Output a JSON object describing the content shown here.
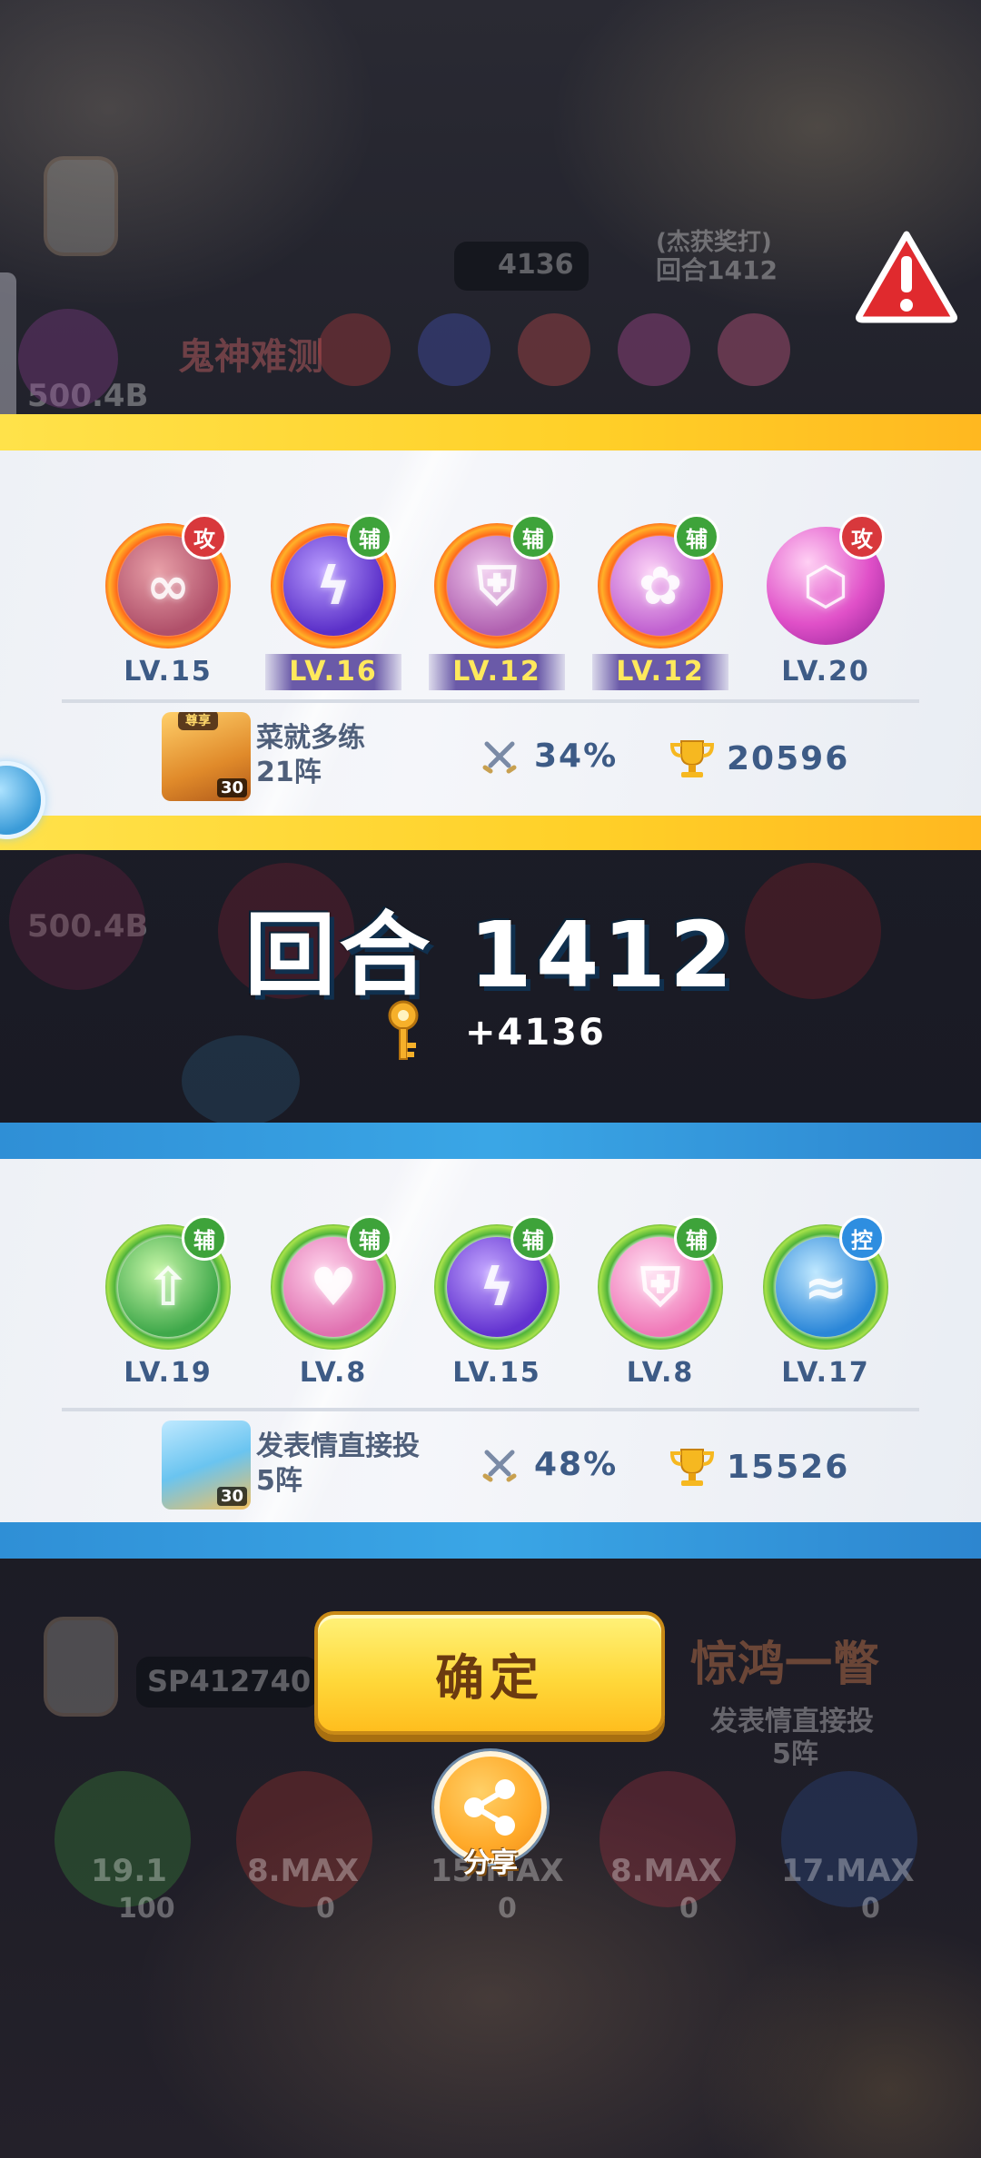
{
  "background": {
    "top_key_count": "4136",
    "top_status_line1": "(杰获奖打)",
    "top_status_round": "回合1412",
    "left_score": "500.4B",
    "mid_left_score": "500.4B",
    "banner_text": "鬼神难测",
    "bottom_sp": "SP412740",
    "bottom_banner": "惊鸿一瞥",
    "bottom_team_name": "发表情直接投",
    "bottom_team_count": "5阵",
    "bottom_slots": [
      {
        "level": "19.1",
        "sp": "100"
      },
      {
        "level": "8.MAX",
        "sp": "0"
      },
      {
        "level": "15.MAX",
        "sp": "0"
      },
      {
        "level": "8.MAX",
        "sp": "0"
      },
      {
        "level": "17.MAX",
        "sp": "0"
      }
    ]
  },
  "opponent_team": {
    "skills": [
      {
        "icon": "infinity-icon",
        "badge": "攻",
        "badge_color": "#d8383c",
        "level": "LV.15",
        "highlight": false
      },
      {
        "icon": "lightning-icon",
        "badge": "辅",
        "badge_color": "#3ea33a",
        "level": "LV.16",
        "highlight": true
      },
      {
        "icon": "shield-wings-icon",
        "badge": "辅",
        "badge_color": "#3ea33a",
        "level": "LV.12",
        "highlight": true
      },
      {
        "icon": "lotus-icon",
        "badge": "辅",
        "badge_color": "#3ea33a",
        "level": "LV.12",
        "highlight": true
      },
      {
        "icon": "broken-shield-icon",
        "badge": "攻",
        "badge_color": "#d8383c",
        "level": "LV.20",
        "highlight": false
      }
    ],
    "player": {
      "avatar_tag": "尊享",
      "avatar_tier": "30",
      "name_line1": "菜就多练",
      "name_line2": "21阵",
      "win_rate": "34%",
      "trophies": "20596"
    }
  },
  "round": {
    "title": "回合 1412",
    "reward": "+4136",
    "reward_icon": "key-icon"
  },
  "player_team": {
    "skills": [
      {
        "icon": "arrow-up-icon",
        "badge": "辅",
        "badge_color": "#3ea33a",
        "level": "LV.19"
      },
      {
        "icon": "strength-icon",
        "badge": "辅",
        "badge_color": "#3ea33a",
        "level": "LV.8"
      },
      {
        "icon": "lightning-icon",
        "badge": "辅",
        "badge_color": "#3ea33a",
        "level": "LV.15"
      },
      {
        "icon": "shield-wings-icon",
        "badge": "辅",
        "badge_color": "#3ea33a",
        "level": "LV.8"
      },
      {
        "icon": "wave-icon",
        "badge": "控",
        "badge_color": "#2e8ee0",
        "level": "LV.17"
      }
    ],
    "player": {
      "avatar_tier": "30",
      "name_line1": "发表情直接投",
      "name_line2": "5阵",
      "win_rate": "48%",
      "trophies": "15526"
    }
  },
  "buttons": {
    "confirm": "确定",
    "share": "分享"
  },
  "colors": {
    "opponent_band": "#ffd028",
    "player_band": "#3aa6e6",
    "confirm_button": "#ffd93b",
    "level_text": "#3d5b86"
  }
}
